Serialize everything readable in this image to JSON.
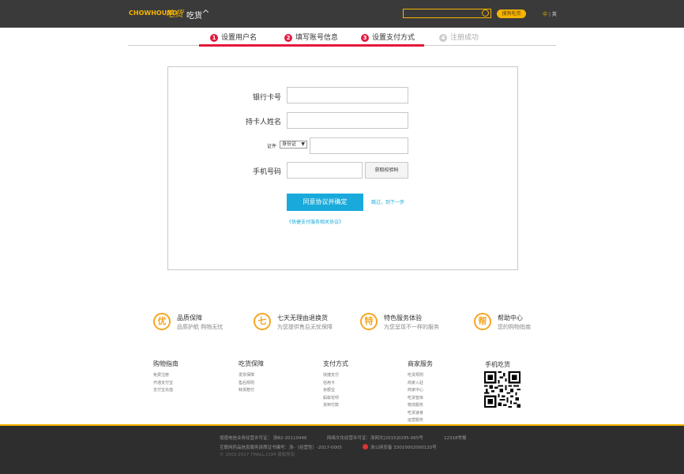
{
  "header": {
    "logo": "CHOWHOUND",
    "logo_cn": "吃货",
    "site_name": "吃货",
    "search_button": "搜狗吃货",
    "lang_zh": "中",
    "lang_sep": "|",
    "lang_en": "英"
  },
  "steps": [
    {
      "num": "1",
      "label": "设置用户名"
    },
    {
      "num": "2",
      "label": "填写账号信息"
    },
    {
      "num": "3",
      "label": "设置支付方式"
    },
    {
      "num": "4",
      "label": "注册成功"
    }
  ],
  "form": {
    "bank_card_label": "银行卡号",
    "cardholder_label": "持卡人姓名",
    "id_label": "证件",
    "id_type": "身份证",
    "phone_label": "手机号码",
    "get_code": "获取校验码",
    "submit": "同意协议并确定",
    "skip": "跳过，到下一步",
    "protocol": "《快捷支付服务相关协议》"
  },
  "guarantees": [
    {
      "icon": "优",
      "title": "品质保障",
      "sub": "品质护航  购物无忧"
    },
    {
      "icon": "七",
      "title": "七天无理由退换货",
      "sub": "为您提供售后无忧保障"
    },
    {
      "icon": "特",
      "title": "特色服务体验",
      "sub": "为您呈现不一样的服务"
    },
    {
      "icon": "帮",
      "title": "帮助中心",
      "sub": "您的购物指南"
    }
  ],
  "footer_cols": [
    {
      "title": "购物指南",
      "links": [
        "免费注册",
        "开通支付宝",
        "支付宝充值"
      ]
    },
    {
      "title": "吃货保障",
      "links": [
        "发票保障",
        "售后规则",
        "缺货赔付"
      ]
    },
    {
      "title": "支付方式",
      "links": [
        "快捷支付",
        "信用卡",
        "余额宝",
        "蚂蚁花呗",
        "货到付款"
      ]
    },
    {
      "title": "商家服务",
      "links": [
        "吃货规则",
        "商家入驻",
        "商家中心",
        "吃货智库",
        "物流服务",
        "吃货速食",
        "运营服务"
      ]
    }
  ],
  "mobile": "手机吃货",
  "bottom": {
    "l1a": "增值电信业务经营许可证：  浙B2-20110446",
    "l1b": "网络文化经营许可证：浙网文[2015]0295-065号",
    "l1c": "12318举报",
    "l2a": "互联网药品信息服务资质证书编号：浙-（经营性）-2017-0005",
    "l2b": "浙公网安备  33010002000120号",
    "l3": "© 2003-2017  TMALL.COM  版权所有"
  }
}
